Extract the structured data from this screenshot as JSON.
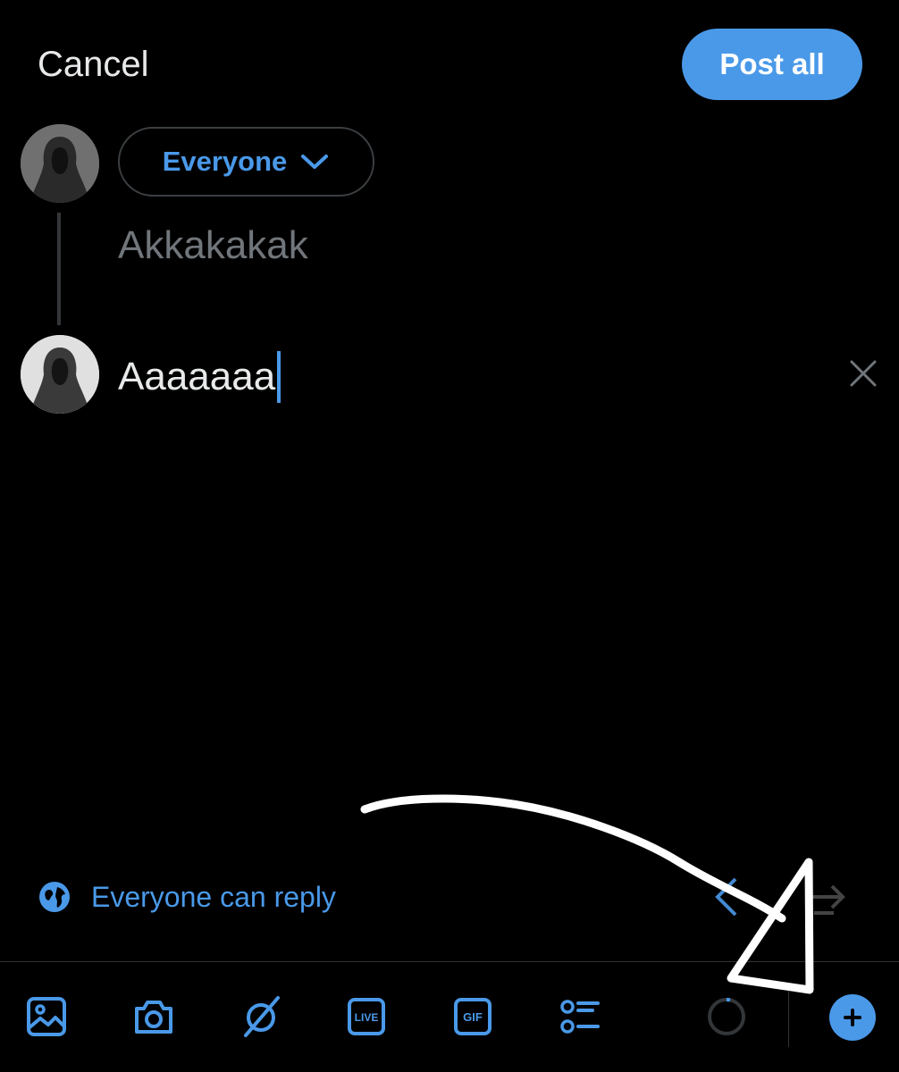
{
  "header": {
    "cancel_label": "Cancel",
    "post_label": "Post all"
  },
  "audience": {
    "label": "Everyone"
  },
  "thread": {
    "tweets": [
      {
        "text": "Akkakakak"
      },
      {
        "text": "Aaaaaaa"
      }
    ]
  },
  "reply_settings": {
    "label": "Everyone can reply"
  },
  "toolbar": {
    "items": [
      "image-icon",
      "camera-icon",
      "grok-icon",
      "live-icon",
      "gif-icon",
      "poll-icon",
      "progress-ring-icon",
      "add-icon"
    ],
    "live_text": "LIVE",
    "gif_text": "GIF"
  },
  "colors": {
    "accent": "#4a99e9",
    "background": "#000000",
    "placeholder": "#71767b",
    "text": "#e7e9ea"
  }
}
